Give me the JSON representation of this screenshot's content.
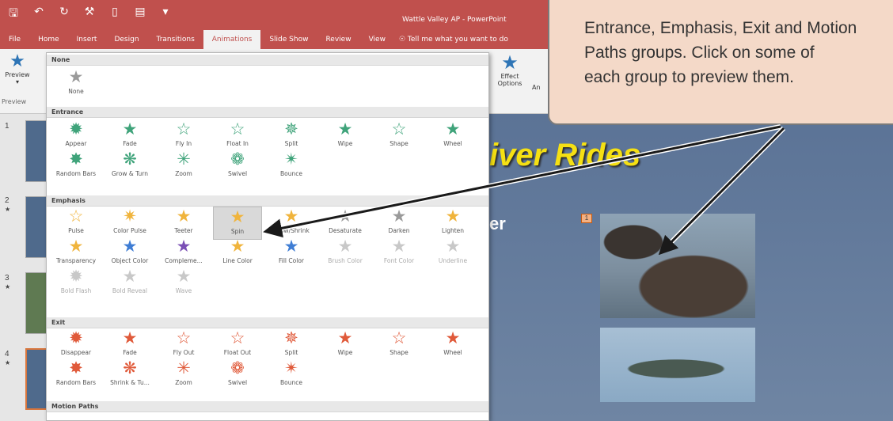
{
  "titlebar": {
    "title": "Wattle Valley AP - PowerPoint",
    "qat": [
      "save-icon",
      "undo-icon",
      "redo-icon",
      "format-icon",
      "new-icon",
      "open-icon",
      "more-icon"
    ]
  },
  "tabs": [
    {
      "label": "File"
    },
    {
      "label": "Home"
    },
    {
      "label": "Insert"
    },
    {
      "label": "Design"
    },
    {
      "label": "Transitions"
    },
    {
      "label": "Animations",
      "active": true
    },
    {
      "label": "Slide Show"
    },
    {
      "label": "Review"
    },
    {
      "label": "View"
    }
  ],
  "tell_me": "Tell me what you want to do",
  "ribbon": {
    "preview_label": "Preview",
    "preview_group": "Preview",
    "effect_options_label": "Effect Options",
    "cut_label": "An"
  },
  "gallery": {
    "sections": [
      {
        "title": "None",
        "effects": [
          {
            "label": "None",
            "icon": "star-gray-icon"
          }
        ]
      },
      {
        "title": "Entrance",
        "effects": [
          {
            "label": "Appear"
          },
          {
            "label": "Fade"
          },
          {
            "label": "Fly In"
          },
          {
            "label": "Float In"
          },
          {
            "label": "Split"
          },
          {
            "label": "Wipe"
          },
          {
            "label": "Shape"
          },
          {
            "label": "Wheel"
          },
          {
            "label": "Random Bars"
          },
          {
            "label": "Grow & Turn"
          },
          {
            "label": "Zoom"
          },
          {
            "label": "Swivel"
          },
          {
            "label": "Bounce"
          }
        ]
      },
      {
        "title": "Emphasis",
        "effects": [
          {
            "label": "Pulse"
          },
          {
            "label": "Color Pulse"
          },
          {
            "label": "Teeter"
          },
          {
            "label": "Spin"
          },
          {
            "label": "Grow/Shrink"
          },
          {
            "label": "Desaturate"
          },
          {
            "label": "Darken"
          },
          {
            "label": "Lighten"
          },
          {
            "label": "Transparency"
          },
          {
            "label": "Object Color"
          },
          {
            "label": "Compleme..."
          },
          {
            "label": "Line Color"
          },
          {
            "label": "Fill Color"
          },
          {
            "label": "Brush Color"
          },
          {
            "label": "Font Color"
          },
          {
            "label": "Underline"
          },
          {
            "label": "Bold Flash"
          },
          {
            "label": "Bold Reveal"
          },
          {
            "label": "Wave"
          }
        ]
      },
      {
        "title": "Exit",
        "effects": [
          {
            "label": "Disappear"
          },
          {
            "label": "Fade"
          },
          {
            "label": "Fly Out"
          },
          {
            "label": "Float Out"
          },
          {
            "label": "Split"
          },
          {
            "label": "Wipe"
          },
          {
            "label": "Shape"
          },
          {
            "label": "Wheel"
          },
          {
            "label": "Random Bars"
          },
          {
            "label": "Shrink & Tu..."
          },
          {
            "label": "Zoom"
          },
          {
            "label": "Swivel"
          },
          {
            "label": "Bounce"
          }
        ]
      },
      {
        "title": "Motion Paths",
        "effects": []
      }
    ]
  },
  "thumbnails": [
    {
      "number": "1",
      "star": ""
    },
    {
      "number": "2",
      "star": "★"
    },
    {
      "number": "3",
      "star": "★"
    },
    {
      "number": "4",
      "star": "★",
      "selected": true
    }
  ],
  "slide": {
    "title": "iver Rides",
    "text": "er",
    "marker": "1"
  },
  "callout": {
    "text": "Entrance, Emphasis, Exit and Motion\nPaths groups.  Click on some of\neach group to preview them."
  }
}
